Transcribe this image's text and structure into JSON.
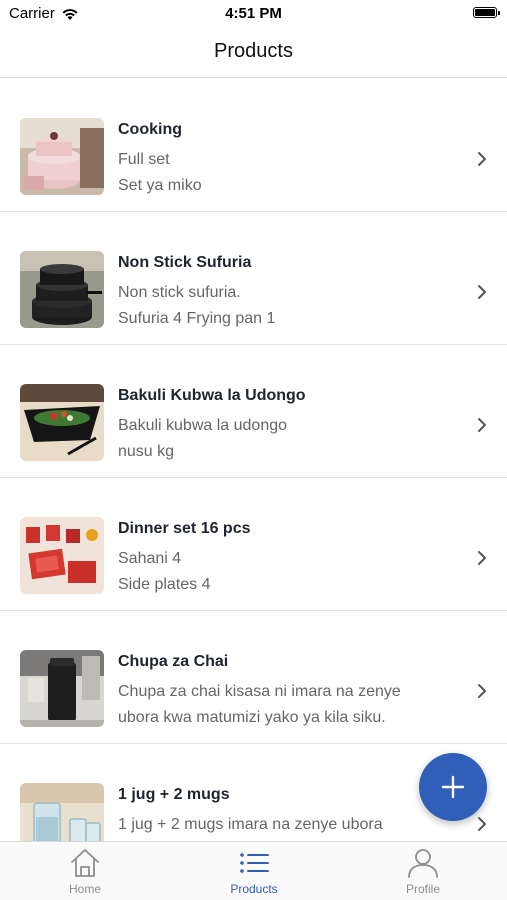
{
  "status_bar": {
    "carrier": "Carrier",
    "time": "4:51 PM",
    "icons": [
      "wifi-icon",
      "battery-icon"
    ]
  },
  "header": {
    "title": "Products"
  },
  "products": [
    {
      "name": "Cooking",
      "line1": "Full set",
      "line2": "Set ya miko",
      "thumbnail": "pink-cookware-photo"
    },
    {
      "name": "Non Stick Sufuria",
      "line1": "Non stick sufuria.",
      "line2": "Sufuria 4 Frying pan 1",
      "thumbnail": "black-pots-photo"
    },
    {
      "name": "Bakuli Kubwa la Udongo",
      "line1": "Bakuli kubwa la udongo",
      "line2": "nusu kg",
      "thumbnail": "black-bowl-salad-photo"
    },
    {
      "name": "Dinner set 16 pcs",
      "line1": "Sahani 4",
      "line2": "Side plates 4",
      "thumbnail": "red-dinner-set-photo"
    },
    {
      "name": "Chupa za Chai",
      "line1": "Chupa za chai kisasa ni  imara na zenye",
      "line2": "ubora kwa matumizi yako ya kila siku.",
      "thumbnail": "black-flask-photo"
    },
    {
      "name": "1 jug + 2 mugs",
      "line1": "1 jug + 2 mugs  imara na zenye ubora",
      "line2": "",
      "thumbnail": "glass-jug-photo"
    }
  ],
  "fab": {
    "icon": "plus-icon",
    "color": "#2f5fb8"
  },
  "tabs": [
    {
      "label": "Home",
      "icon": "home-icon",
      "active": false
    },
    {
      "label": "Products",
      "icon": "list-icon",
      "active": true
    },
    {
      "label": "Profile",
      "icon": "profile-icon",
      "active": false
    }
  ],
  "colors": {
    "accent": "#2f5fb8",
    "inactive": "#8e8e8e"
  }
}
